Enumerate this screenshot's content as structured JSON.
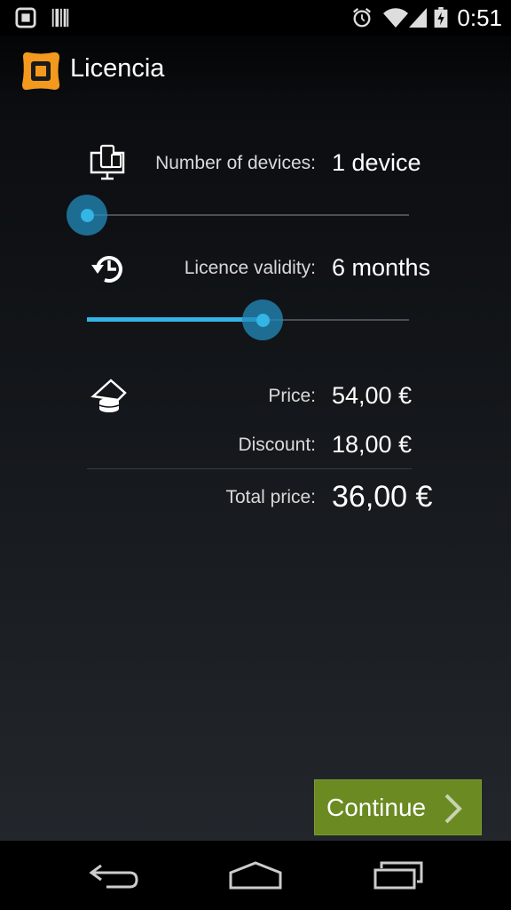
{
  "status_bar": {
    "time": "0:51",
    "left_icons": [
      "app-notification-icon",
      "barcode-icon"
    ],
    "right_icons": [
      "alarm-icon",
      "wifi-icon",
      "signal-icon",
      "battery-charging-icon"
    ]
  },
  "action_bar": {
    "title": "Licencia",
    "logo_icon": "app-logo-icon"
  },
  "devices": {
    "icon": "devices-icon",
    "label": "Number of devices:",
    "value": "1 device",
    "slider_fraction": 0.0
  },
  "validity": {
    "icon": "history-clock-icon",
    "label": "Licence validity:",
    "value": "6 months",
    "slider_fraction": 0.55
  },
  "pricing": {
    "icon": "coins-icon",
    "price_label": "Price:",
    "price_value": "54,00 €",
    "discount_label": "Discount:",
    "discount_value": "18,00 €",
    "total_label": "Total price:",
    "total_value": "36,00 €"
  },
  "continue_button": {
    "label": "Continue",
    "icon": "chevron-right-icon"
  },
  "nav_bar": {
    "icons": [
      "back-icon",
      "home-icon",
      "recent-apps-icon"
    ]
  },
  "colors": {
    "accent": "#33b5e5",
    "button": "#6b8a22",
    "logo": "#f39a1e"
  }
}
